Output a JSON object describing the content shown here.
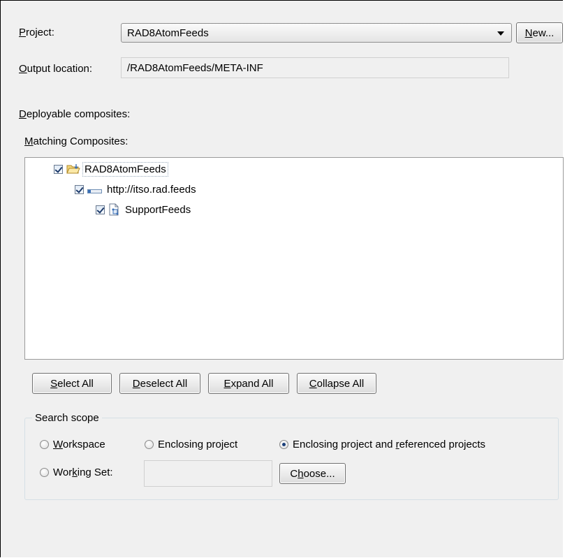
{
  "project": {
    "label_pre": "",
    "label_u": "P",
    "label_post": "roject:",
    "selected": "RAD8AtomFeeds",
    "new_button_u": "N",
    "new_button_post": "ew..."
  },
  "output": {
    "label_u": "O",
    "label_post": "utput location:",
    "value": "/RAD8AtomFeeds/META-INF"
  },
  "deployable": {
    "label_u": "D",
    "label_post": "eployable composites:"
  },
  "matching": {
    "label_u": "M",
    "label_post": "atching Composites:"
  },
  "tree": [
    {
      "label": "RAD8AtomFeeds",
      "icon": "project-folder-icon",
      "checked": true
    },
    {
      "label": "http://itso.rad.feeds",
      "icon": "namespace-icon",
      "checked": true
    },
    {
      "label": "SupportFeeds",
      "icon": "composite-file-icon",
      "checked": true
    }
  ],
  "buttons": {
    "select_all_u": "S",
    "select_all_post": "elect All",
    "deselect_all_u": "D",
    "deselect_all_post": "eselect All",
    "expand_all_u": "E",
    "expand_all_post": "xpand All",
    "collapse_all_u": "C",
    "collapse_all_post": "ollapse All"
  },
  "scope": {
    "title": "Search scope",
    "workspace_u": "W",
    "workspace_post": "orkspace",
    "enclosing": "Enclosing project",
    "enclosing_ref_pre": "Enclosing project and ",
    "enclosing_ref_u": "r",
    "enclosing_ref_post": "eferenced projects",
    "working_set_pre": "Wor",
    "working_set_u": "k",
    "working_set_post": "ing Set:",
    "working_set_value": "",
    "choose_pre": "C",
    "choose_u": "h",
    "choose_post": "oose...",
    "selected": "enclosing_ref"
  }
}
